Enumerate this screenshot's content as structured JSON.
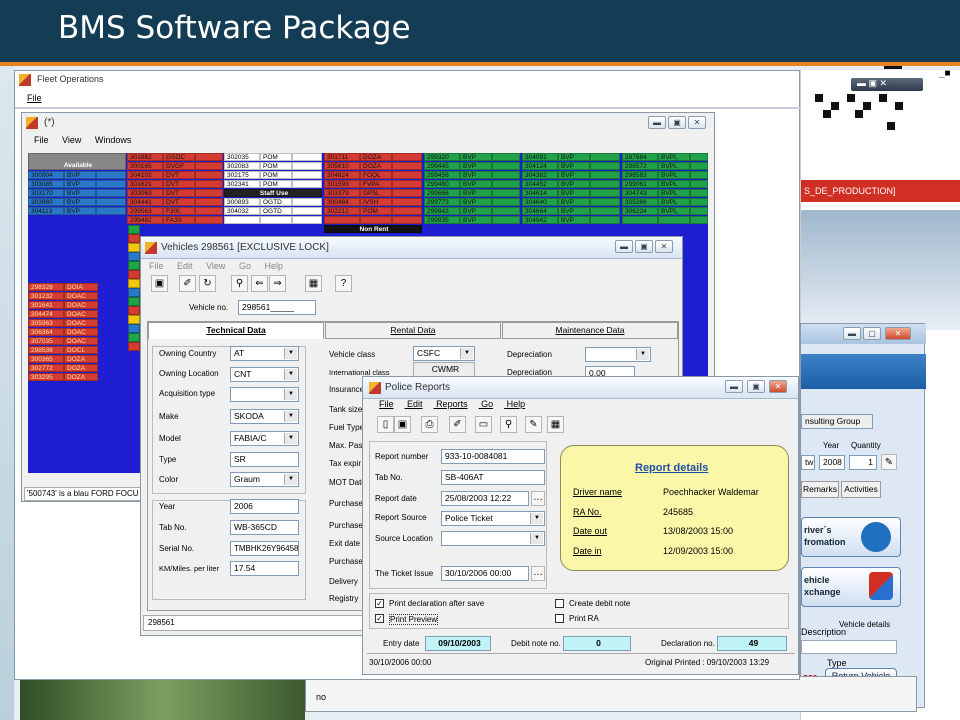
{
  "slide": {
    "title": "BMS Software Package"
  },
  "fleet": {
    "title": "Fleet Operations",
    "menu_file": "File"
  },
  "inner": {
    "title": "(*)",
    "menu": [
      "File",
      "View",
      "Windows"
    ],
    "status": "'500743' is a blau FORD FOCU",
    "col1_header": "Available",
    "col3_header": "Staff Use",
    "col4_header": "Non Rent"
  },
  "grid_cols": [
    {
      "bg": "#2a78c7",
      "rows": [
        [
          "",
          "",
          ""
        ],
        [
          "299946",
          "BVP",
          ""
        ],
        [
          "300904",
          "BVP",
          ""
        ],
        [
          "303085",
          "BVP",
          ""
        ],
        [
          "303170",
          "BVP",
          ""
        ],
        [
          "303860",
          "BVP",
          ""
        ],
        [
          "304113",
          "BVP",
          ""
        ]
      ]
    },
    {
      "bg": "#d43b32",
      "rows": [
        [
          "301862",
          "GSOC",
          ""
        ],
        [
          "300165",
          "DVGF",
          ""
        ],
        [
          "304102",
          "DVT",
          ""
        ],
        [
          "301621",
          "DVT",
          ""
        ],
        [
          "303063",
          "DVT",
          ""
        ],
        [
          "304441",
          "DVT",
          ""
        ],
        [
          "299563",
          "F30L",
          ""
        ],
        [
          "299482",
          "FA3S",
          ""
        ]
      ]
    },
    {
      "bg": "#ffffff",
      "rows": [
        [
          "302035",
          "POM",
          ""
        ],
        [
          "302083",
          "POM",
          ""
        ],
        [
          "302175",
          "POM",
          ""
        ],
        [
          "302341",
          "POM",
          ""
        ],
        [
          "",
          "",
          ""
        ],
        [
          "300893",
          "OGTD",
          ""
        ],
        [
          "304032",
          "OGTD",
          ""
        ],
        [
          "",
          "",
          ""
        ]
      ]
    },
    {
      "bg": "#d43b32",
      "rows": [
        [
          "301711",
          "DOZA",
          ""
        ],
        [
          "305610",
          "DOZA",
          ""
        ],
        [
          "304824",
          "FOQL",
          ""
        ],
        [
          "301593",
          "FVPA",
          ""
        ],
        [
          "303379",
          "GP5L",
          ""
        ],
        [
          "300484",
          "IVSH",
          ""
        ],
        [
          "302212",
          "POM",
          ""
        ],
        [
          "",
          "",
          ""
        ]
      ]
    },
    {
      "bg": "#1fa24a",
      "rows": [
        [
          "299320",
          "BVP",
          ""
        ],
        [
          "299445",
          "BVP",
          ""
        ],
        [
          "299456",
          "BVP",
          ""
        ],
        [
          "299460",
          "BVP",
          ""
        ],
        [
          "299666",
          "BVP",
          ""
        ],
        [
          "299773",
          "BVP",
          ""
        ],
        [
          "299843",
          "BVP",
          ""
        ],
        [
          "299935",
          "BVP",
          ""
        ]
      ]
    },
    {
      "bg": "#1fa24a",
      "rows": [
        [
          "304091",
          "BVP",
          ""
        ],
        [
          "304124",
          "BVP",
          ""
        ],
        [
          "304382",
          "BVP",
          ""
        ],
        [
          "304452",
          "BVP",
          ""
        ],
        [
          "304614",
          "BVP",
          ""
        ],
        [
          "304640",
          "BVP",
          ""
        ],
        [
          "304664",
          "BVP",
          ""
        ],
        [
          "304942",
          "BVP",
          ""
        ]
      ]
    },
    {
      "bg": "#1fa24a",
      "rows": [
        [
          "297684",
          "BVPL",
          ""
        ],
        [
          "298572",
          "BVPL",
          ""
        ],
        [
          "298583",
          "BVPL",
          ""
        ],
        [
          "299061",
          "BVPL",
          ""
        ],
        [
          "304743",
          "BVPL",
          ""
        ],
        [
          "305366",
          "BVPL",
          ""
        ],
        [
          "306224",
          "BVPL",
          ""
        ],
        [
          "",
          "",
          ""
        ]
      ]
    }
  ],
  "left_col_rows": [
    [
      "298328",
      "DOIA"
    ],
    [
      "301232",
      "DOAC"
    ],
    [
      "301641",
      "DOAC"
    ],
    [
      "304474",
      "DOAC"
    ],
    [
      "305963",
      "DOAC"
    ],
    [
      "306364",
      "DOAC"
    ],
    [
      "307035",
      "DOAC"
    ],
    [
      "298538",
      "DOCL"
    ],
    [
      "300365",
      "DOZA"
    ],
    [
      "302772",
      "DOZA"
    ],
    [
      "303295",
      "DOZA"
    ]
  ],
  "vehicles": {
    "title": "Vehicles  298561  [EXCLUSIVE LOCK]",
    "menu": [
      "File",
      "Edit",
      "View",
      "Go",
      "Help"
    ],
    "vehicle_no_label": "Vehicle no.",
    "vehicle_no": "298561_____",
    "tabs": [
      "Technical Data",
      "Rental Data",
      "Maintenance Data"
    ],
    "owning_country_label": "Owning Country",
    "owning_country": "AT",
    "owning_location_label": "Owning Location",
    "owning_location": "CNT",
    "acq_label": "Acquisition type",
    "acq": "",
    "make_label": "Make",
    "make": "SKODA",
    "model_label": "Model",
    "model": "FABIA/C",
    "type_label": "Type",
    "type": "SR",
    "color_label": "Color",
    "color": "Graum",
    "year_label": "Year",
    "year": "2006",
    "tab_label": "Tab No.",
    "tab": "WB-365CD",
    "serial_label": "Serial No.",
    "serial": "TMBHK26Y96458",
    "km_label": "KM/Miles. per liter",
    "km": "17.54",
    "vclass_label": "Vehicle class",
    "vclass": "CSFC",
    "intl_label": "International class",
    "intl": "CWMR",
    "dep_label": "Depreciation",
    "dep2_label": "Depreciation",
    "dep2": "0.00",
    "mid_labels": [
      "Insurance",
      "Tank size",
      "Fuel Type",
      "Max. Pas",
      "Tax expir",
      "MOT Date",
      "Purchase",
      "Purchase",
      "Exit date",
      "Purchase",
      "Delivery",
      "Registry"
    ],
    "status": "298561"
  },
  "police": {
    "title": "Police Reports",
    "menu": [
      "File",
      "Edit",
      "Reports",
      "Go",
      "Help"
    ],
    "report_number_label": "Report number",
    "report_number": "933-10-0084081",
    "tab_no_label": "Tab No.",
    "tab_no": "SB-406AT",
    "report_date_label": "Report date",
    "report_date": "25/08/2003  12:22",
    "report_source_label": "Report Source",
    "report_source": "Police Ticket",
    "source_location_label": "Source Location",
    "source_location": "",
    "ticket_issue_label": "The Ticket Issue",
    "ticket_issue": "30/10/2006  00:00",
    "details_title": "Report details",
    "driver_label": "Driver name",
    "driver": "Poechhacker Waldemar",
    "ra_label": "RA No.",
    "ra": "245685",
    "date_out_label": "Date out",
    "date_out": "13/08/2003  15:00",
    "date_in_label": "Date in",
    "date_in": "12/09/2003  15:00",
    "chk1": "Print declaration after save",
    "chk2": "Print Preview",
    "chk3": "Create debit note",
    "chk4": "Print RA",
    "entry_date_label": "Entry date",
    "entry_date": "09/10/2003",
    "debit_label": "Debit note no.",
    "debit": "0",
    "decl_label": "Declaration no.",
    "decl": "49",
    "status_left": "30/10/2006  00:00",
    "status_right": "Original Printed :  09/10/2003  13:29"
  },
  "right": {
    "banner": "S_DE_PRODUCTION]",
    "group": "nsulting Group",
    "year_label": "Year",
    "qty_label": "Quantity",
    "tw": "tw",
    "year": "2008",
    "qty": "1",
    "tab_remarks": "Remarks",
    "tab_activities": "Activities",
    "drivers": "river´s\nfromation",
    "vehicle": "ehicle\nxchange",
    "vdetails": "Vehicle details",
    "description": "Description",
    "type": "Type",
    "car": "car",
    "return_btn": "Return Vehicle",
    "no": "no"
  }
}
